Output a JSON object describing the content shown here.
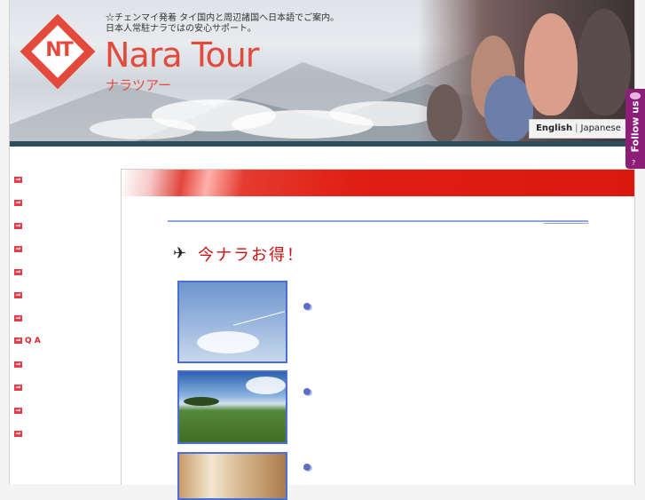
{
  "header": {
    "tagline_line1": "☆チェンマイ発着 タイ国内と周辺諸国へ日本語でご案内。",
    "tagline_line2": "日本人常駐ナラではの安心サポート。",
    "logo_mark": "NT",
    "brand": "Nara Tour",
    "brand_kana": "ナラツアー",
    "lang_english": "English",
    "lang_sep": "|",
    "lang_japanese": "Japanese"
  },
  "sidebar": {
    "items": [
      {
        "label": ""
      },
      {
        "label": ""
      },
      {
        "label": ""
      },
      {
        "label": ""
      },
      {
        "label": ""
      },
      {
        "label": ""
      },
      {
        "label": ""
      },
      {
        "label": "Q A"
      },
      {
        "label": ""
      },
      {
        "label": ""
      },
      {
        "label": ""
      },
      {
        "label": ""
      }
    ]
  },
  "main": {
    "heading": "今ナラお得！"
  },
  "follow": {
    "label": "Follow us",
    "help": "?"
  },
  "colors": {
    "brand_red": "#e44a3c",
    "header_bar": "#2d4e5c",
    "follow_purple": "#8d1e78",
    "thumb_border": "#4b6fd8"
  }
}
